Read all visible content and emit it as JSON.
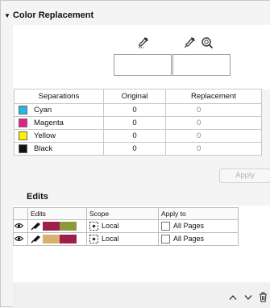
{
  "panel": {
    "title": "Color Replacement"
  },
  "toolbar": {
    "eyedropper_original": "eyedropper-icon",
    "eyedropper_replacement": "eyedropper-icon",
    "zoom": "zoom-icon"
  },
  "separations": {
    "headers": [
      "Separations",
      "Original",
      "Replacement"
    ],
    "rows": [
      {
        "name": "Cyan",
        "color": "#29b6e6",
        "original": "0",
        "replacement": "0"
      },
      {
        "name": "Magenta",
        "color": "#e91e8c",
        "original": "0",
        "replacement": "0"
      },
      {
        "name": "Yellow",
        "color": "#ffee00",
        "original": "0",
        "replacement": "0"
      },
      {
        "name": "Black",
        "color": "#111111",
        "original": "0",
        "replacement": "0"
      }
    ]
  },
  "apply_button": {
    "label": "Apply"
  },
  "edits": {
    "title": "Edits",
    "headers": [
      "Edits",
      "Scope",
      "Apply to"
    ],
    "rows": [
      {
        "from_color": "#9e1f4a",
        "to_color": "#8c9a3c",
        "scope": "Local",
        "apply_to": "All Pages"
      },
      {
        "from_color": "#d8b070",
        "to_color": "#9e1f4a",
        "scope": "Local",
        "apply_to": "All Pages"
      }
    ]
  },
  "footer": {
    "move_up": "chevron-up-icon",
    "move_down": "chevron-down-icon",
    "delete": "trash-icon"
  }
}
